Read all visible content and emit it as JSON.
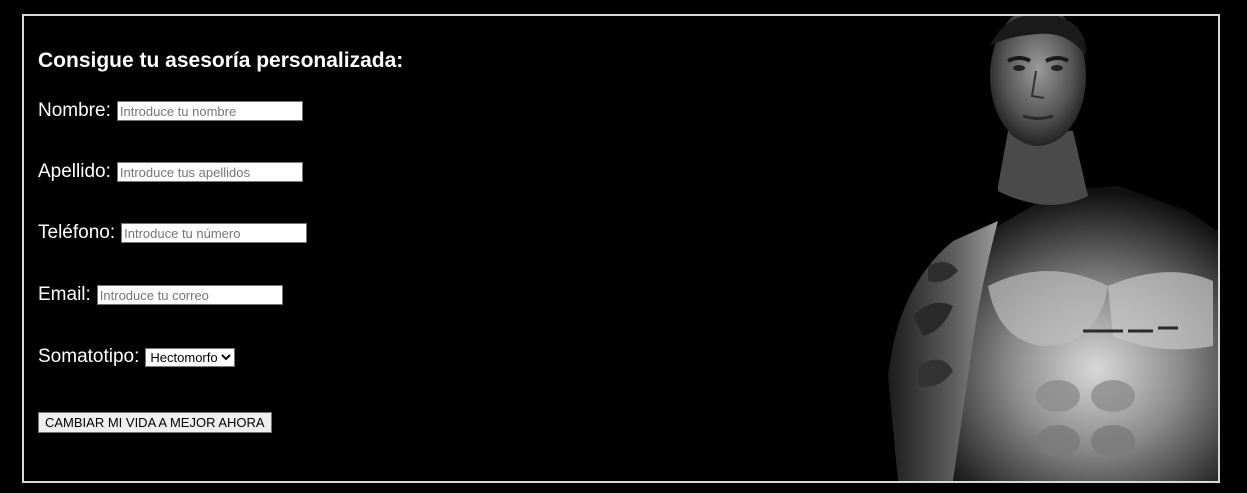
{
  "form": {
    "title": "Consigue tu asesoría personalizada:",
    "nombre_label": "Nombre:",
    "nombre_placeholder": "Introduce tu nombre",
    "apellido_label": "Apellido:",
    "apellido_placeholder": "Introduce tus apellidos",
    "telefono_label": "Teléfono:",
    "telefono_placeholder": "Introduce tu número",
    "email_label": "Email:",
    "email_placeholder": "Introduce tu correo",
    "somatotipo_label": "Somatotipo:",
    "somatotipo_selected": "Hectomorfo",
    "submit_label": "CAMBIAR MI VIDA A MEJOR AHORA"
  },
  "colors": {
    "background": "#000000",
    "frame_border": "#d8d8d8",
    "text": "#ffffff"
  }
}
